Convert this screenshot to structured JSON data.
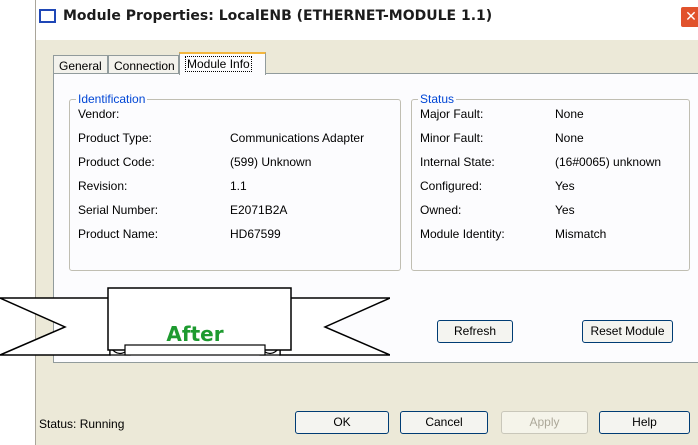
{
  "window": {
    "title": "Module Properties: LocalENB (ETHERNET-MODULE 1.1)",
    "close_icon": "close-icon",
    "accent": "#1f47b6"
  },
  "tabs": [
    {
      "label": "General"
    },
    {
      "label": "Connection"
    },
    {
      "label": "Module Info",
      "active": true
    }
  ],
  "identification": {
    "title": "Identification",
    "rows": [
      {
        "label": "Vendor:",
        "value": ""
      },
      {
        "label": "Product Type:",
        "value": "Communications Adapter"
      },
      {
        "label": "Product Code:",
        "value": "(599) Unknown"
      },
      {
        "label": "Revision:",
        "value": "1.1"
      },
      {
        "label": "Serial Number:",
        "value": "E2071B2A"
      },
      {
        "label": "Product Name:",
        "value": "HD67599"
      }
    ]
  },
  "status_group": {
    "title": "Status",
    "rows": [
      {
        "label": "Major Fault:",
        "value": "None"
      },
      {
        "label": "Minor Fault:",
        "value": "None"
      },
      {
        "label": "Internal State:",
        "value": "(16#0065) unknown"
      },
      {
        "label": "Configured:",
        "value": "Yes"
      },
      {
        "label": "Owned:",
        "value": "Yes"
      },
      {
        "label": "Module Identity:",
        "value": "Mismatch"
      }
    ]
  },
  "buttons": {
    "refresh": "Refresh",
    "reset_module": "Reset Module",
    "ok": "OK",
    "cancel": "Cancel",
    "apply": "Apply",
    "help": "Help"
  },
  "footer": {
    "status": "Status:  Running"
  },
  "banner": {
    "text": "After",
    "color": "#1d9a2f"
  }
}
